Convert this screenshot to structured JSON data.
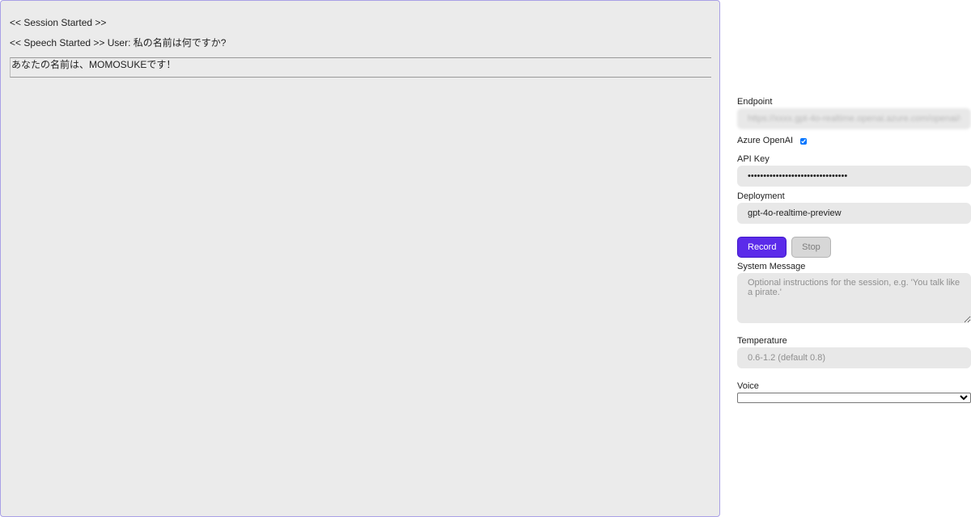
{
  "log": {
    "lines": [
      "<< Session Started >>",
      "<< Speech Started >> User: 私の名前は何ですか?"
    ],
    "response": "あなたの名前は、MOMOSUKEです！"
  },
  "settings": {
    "endpoint": {
      "label": "Endpoint",
      "value": "https://xxxx.gpt-4o-realtime.openai.azure.com/openai/r"
    },
    "azure_openai": {
      "label": "Azure OpenAI",
      "checked": true
    },
    "api_key": {
      "label": "API Key",
      "value": "••••••••••••••••••••••••••••••••"
    },
    "deployment": {
      "label": "Deployment",
      "value": "gpt-4o-realtime-preview"
    },
    "buttons": {
      "record": "Record",
      "stop": "Stop"
    },
    "system_message": {
      "label": "System Message",
      "placeholder": "Optional instructions for the session, e.g. 'You talk like a pirate.'"
    },
    "temperature": {
      "label": "Temperature",
      "placeholder": "0.6-1.2 (default 0.8)"
    },
    "voice": {
      "label": "Voice",
      "selected": ""
    }
  },
  "colors": {
    "accent": "#5b2bea",
    "panel_border": "#a9a0e6",
    "panel_bg": "#ebebeb"
  }
}
